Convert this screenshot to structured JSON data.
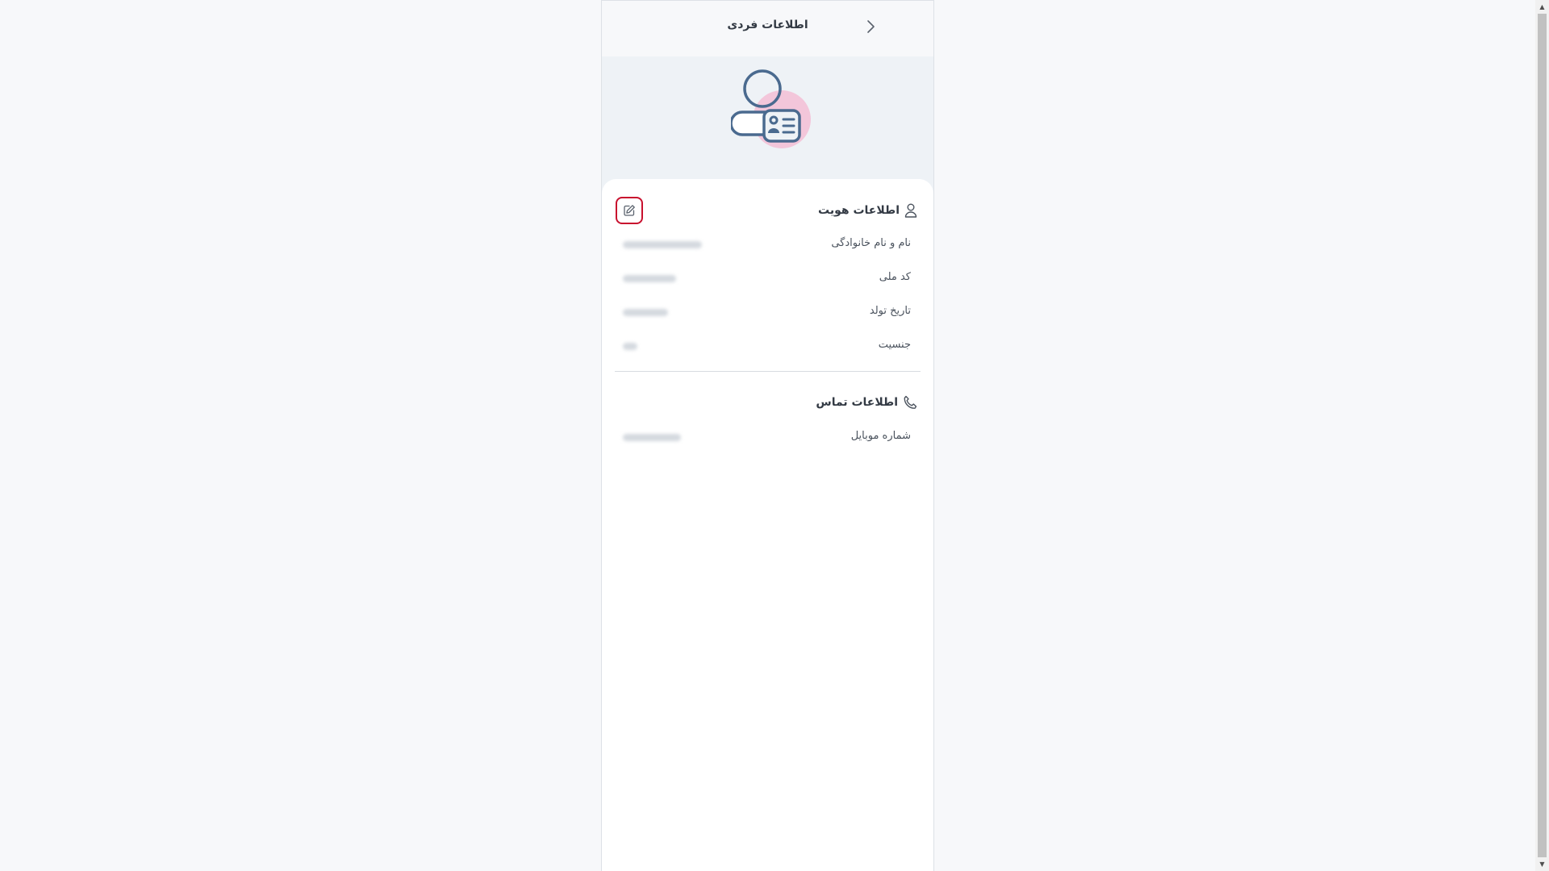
{
  "header": {
    "title": "اطلاعات فردی"
  },
  "identity": {
    "title": "اطلاعات هویت",
    "fields": [
      {
        "label": "نام و نام خانوادگی",
        "value": ""
      },
      {
        "label": "کد ملی",
        "value": ""
      },
      {
        "label": "تاریخ تولد",
        "value": ""
      },
      {
        "label": "جنسیت",
        "value": ""
      }
    ]
  },
  "contact": {
    "title": "اطلاعات تماس",
    "fields": [
      {
        "label": "شماره موبایل",
        "value": ""
      }
    ]
  },
  "icons": {
    "back": "chevron-right-icon",
    "identity": "user-icon",
    "contact": "phone-icon",
    "edit": "edit-icon"
  },
  "colors": {
    "accent_border": "#c8102e",
    "illustration_stroke": "#4a6a8f",
    "illustration_circle": "#f3c6da",
    "hero_bg": "#eef2f6"
  }
}
